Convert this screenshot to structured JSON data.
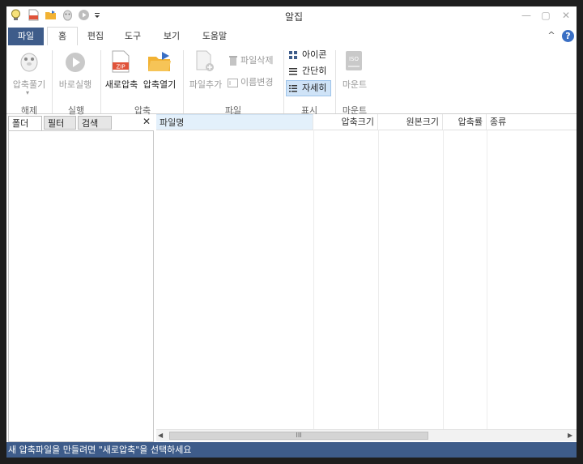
{
  "window": {
    "title": "알집"
  },
  "quick_access": [
    "bulb-icon",
    "zip-icon",
    "folder-open-icon",
    "mascot-icon",
    "play-icon",
    "customize-icon"
  ],
  "window_controls": {
    "minimize": "—",
    "maximize": "▢",
    "close": "✕"
  },
  "ribbon_tabs": [
    "파일",
    "홈",
    "편집",
    "도구",
    "보기",
    "도움말"
  ],
  "help": {
    "collapse": "^",
    "help": "?"
  },
  "ribbon": {
    "extract": {
      "button": "압축풀기",
      "group": "해제"
    },
    "run": {
      "button": "바로실행",
      "group": "실행"
    },
    "compress": {
      "new_zip": "새로압축",
      "open_zip": "압축열기",
      "group": "압축"
    },
    "file": {
      "add": "파일추가",
      "delete": "파일삭제",
      "rename": "이름변경",
      "group": "파일"
    },
    "view": {
      "icons": "아이콘",
      "simple": "간단히",
      "details": "자세히",
      "group": "표시"
    },
    "mount": {
      "button": "마운트",
      "group": "마운트",
      "iso_label": "ISO"
    }
  },
  "side_panel": {
    "tabs": [
      "폴더",
      "필터",
      "검색"
    ],
    "close": "✕"
  },
  "file_list": {
    "columns": [
      "파일명",
      "압축크기",
      "원본크기",
      "압축률",
      "종류"
    ]
  },
  "scrollbar": {
    "grip": "III"
  },
  "status": "새 압축파일을 만들려면 \"새로압축\"을 선택하세요",
  "colors": {
    "accent": "#3e5c8a",
    "icon_blue": "#3a6fc4",
    "zip_red": "#e0533a",
    "folder_yellow": "#f2b233"
  }
}
